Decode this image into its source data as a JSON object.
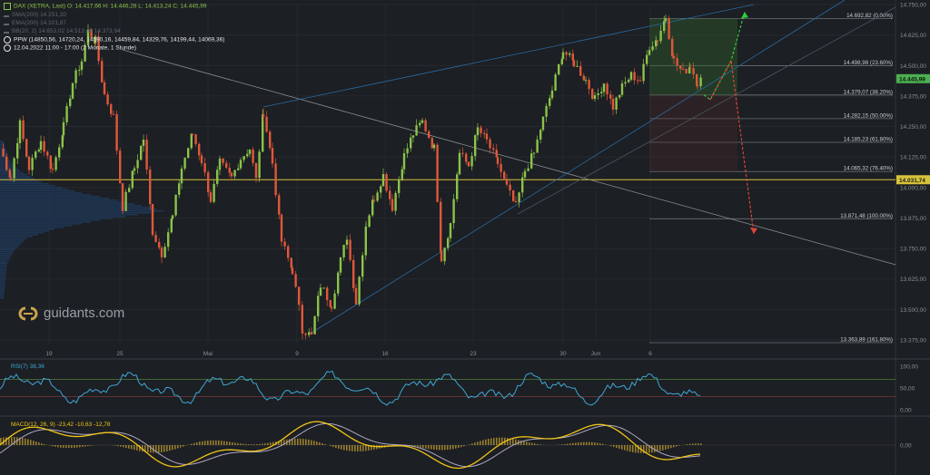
{
  "header": {
    "symbol_line": "DAX (XETRA, Last)  O: 14.417,66  H: 14.446,28  L: 14.413,24  C: 14.445,99",
    "sma_line": "SMA(200)  14.251,30",
    "ema_line": "EMA(200)  14.101,87",
    "bb_line": "BB(20, 2)  14.653,02  14.513,49  14.373,94",
    "ppw_line": "PPW  (14850,56, 14720,24, 14590,16, 14459,84, 14329,76, 14199,44, 14069,36)",
    "date_line": "12.04.2022 11:00 - 17:00  (2 Monate, 1 Stunde)"
  },
  "logo": {
    "text": "guidants.com"
  },
  "colors": {
    "up": "#8bc34a",
    "down": "#e0573b",
    "rsi": "#3fa7d6",
    "macd": "#f0c419",
    "signal": "#b0a8c8",
    "support": "#d8c23a",
    "bg": "#1c1f23"
  },
  "chart_data": [
    {
      "type": "candlestick",
      "title": "DAX (XETRA, Last)",
      "timeframe": "1 Stunde",
      "ylim": [
        13375,
        14750
      ],
      "y_ticks": [
        "14.750,00",
        "14.625,00",
        "14.500,00",
        "14.375,00",
        "14.250,00",
        "14.125,00",
        "14.000,00",
        "13.875,00",
        "13.750,00",
        "13.625,00",
        "13.500,00",
        "13.375,00"
      ],
      "x_ticks": [
        "19",
        "25",
        "Mai",
        "9",
        "16",
        "23",
        "30",
        "Jun",
        "6"
      ],
      "last_price": "14.445,99",
      "support_level": "14.031,74",
      "fib_levels": [
        {
          "label": "14.692,82 (0.00%)",
          "value": 14692.82
        },
        {
          "label": "14.498,98 (23.60%)",
          "value": 14498.98
        },
        {
          "label": "14.379,07 (38.20%)",
          "value": 14379.07
        },
        {
          "label": "14.282,15 (50.00%)",
          "value": 14282.15
        },
        {
          "label": "14.185,23 (61.80%)",
          "value": 14185.23
        },
        {
          "label": "14.065,32 (76.40%)",
          "value": 14065.32
        },
        {
          "label": "13.871,48 (100.00%)",
          "value": 13871.48
        },
        {
          "label": "13.363,89 (161.80%)",
          "value": 13363.89
        }
      ],
      "path": [
        [
          0,
          14160
        ],
        [
          12,
          14040
        ],
        [
          22,
          14260
        ],
        [
          32,
          14080
        ],
        [
          45,
          14190
        ],
        [
          58,
          14070
        ],
        [
          70,
          14250
        ],
        [
          80,
          14430
        ],
        [
          90,
          14520
        ],
        [
          97,
          14640
        ],
        [
          105,
          14600
        ],
        [
          115,
          14380
        ],
        [
          125,
          14290
        ],
        [
          135,
          13920
        ],
        [
          148,
          14080
        ],
        [
          158,
          14200
        ],
        [
          168,
          13820
        ],
        [
          178,
          13730
        ],
        [
          190,
          13880
        ],
        [
          200,
          14080
        ],
        [
          212,
          14220
        ],
        [
          222,
          14110
        ],
        [
          232,
          13950
        ],
        [
          242,
          14100
        ],
        [
          255,
          14040
        ],
        [
          265,
          14120
        ],
        [
          275,
          14160
        ],
        [
          282,
          14030
        ],
        [
          290,
          14310
        ],
        [
          300,
          14100
        ],
        [
          310,
          13780
        ],
        [
          322,
          13660
        ],
        [
          333,
          13420
        ],
        [
          343,
          13390
        ],
        [
          353,
          13600
        ],
        [
          365,
          13520
        ],
        [
          375,
          13700
        ],
        [
          382,
          13800
        ],
        [
          392,
          13530
        ],
        [
          403,
          13850
        ],
        [
          412,
          13960
        ],
        [
          422,
          14050
        ],
        [
          432,
          13920
        ],
        [
          445,
          14130
        ],
        [
          455,
          14220
        ],
        [
          465,
          14270
        ],
        [
          478,
          14160
        ],
        [
          486,
          13710
        ],
        [
          496,
          13850
        ],
        [
          506,
          14140
        ],
        [
          516,
          14090
        ],
        [
          526,
          14240
        ],
        [
          536,
          14190
        ],
        [
          548,
          14100
        ],
        [
          558,
          14000
        ],
        [
          568,
          13920
        ],
        [
          578,
          14070
        ],
        [
          588,
          14140
        ],
        [
          598,
          14280
        ],
        [
          608,
          14400
        ],
        [
          620,
          14560
        ],
        [
          632,
          14510
        ],
        [
          645,
          14440
        ],
        [
          655,
          14360
        ],
        [
          665,
          14430
        ],
        [
          675,
          14330
        ],
        [
          685,
          14410
        ],
        [
          695,
          14460
        ],
        [
          705,
          14440
        ],
        [
          715,
          14580
        ],
        [
          724,
          14610
        ],
        [
          733,
          14700
        ],
        [
          742,
          14520
        ],
        [
          752,
          14470
        ],
        [
          760,
          14500
        ],
        [
          768,
          14430
        ],
        [
          773,
          14446
        ]
      ],
      "projection_up": [
        [
          775,
          14380
        ],
        [
          782,
          14360
        ],
        [
          805,
          14520
        ],
        [
          820,
          14720
        ]
      ],
      "projection_down": [
        [
          782,
          14360
        ],
        [
          805,
          14520
        ],
        [
          830,
          13810
        ]
      ]
    },
    {
      "type": "line",
      "title": "RSI(7)",
      "last_value": "38,36",
      "ylim": [
        0,
        100
      ],
      "y_ticks": [
        "100,00",
        "50,00",
        "0,00"
      ],
      "bands": [
        70,
        30
      ]
    },
    {
      "type": "line",
      "title": "MACD(12, 26, 9)",
      "values_text": "-23,42  -10,63  -12,78",
      "y_ticks": [
        "0,00"
      ]
    }
  ]
}
